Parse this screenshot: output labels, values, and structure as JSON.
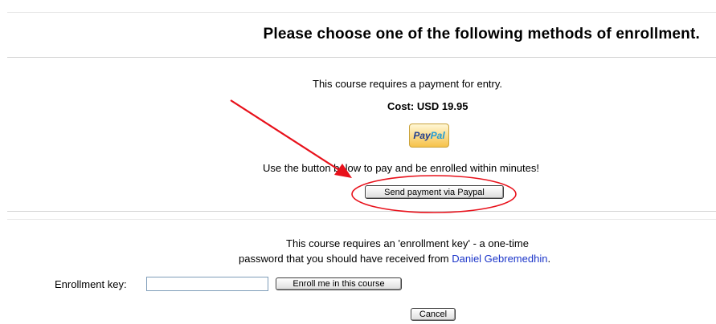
{
  "heading": "Please choose one of the following methods of enrollment.",
  "paypal_section": {
    "requires_text": "This course requires a payment for entry.",
    "cost": "Cost: USD 19.95",
    "logo": {
      "pay": "Pay",
      "pal": "Pal"
    },
    "instruction": "Use the button below to pay and be enrolled within minutes!",
    "button_label": "Send payment via Paypal"
  },
  "key_section": {
    "line1": "This course requires an 'enrollment key' - a one-time",
    "line2_prefix": "password that you should have received from ",
    "teacher_name": "Daniel Gebremedhin",
    "line2_suffix": ".",
    "label": "Enrollment key:",
    "input_value": "",
    "enroll_button_label": "Enroll me in this course",
    "cancel_label": "Cancel"
  },
  "colors": {
    "link": "#1b35c9",
    "annotation": "#e8111b"
  }
}
